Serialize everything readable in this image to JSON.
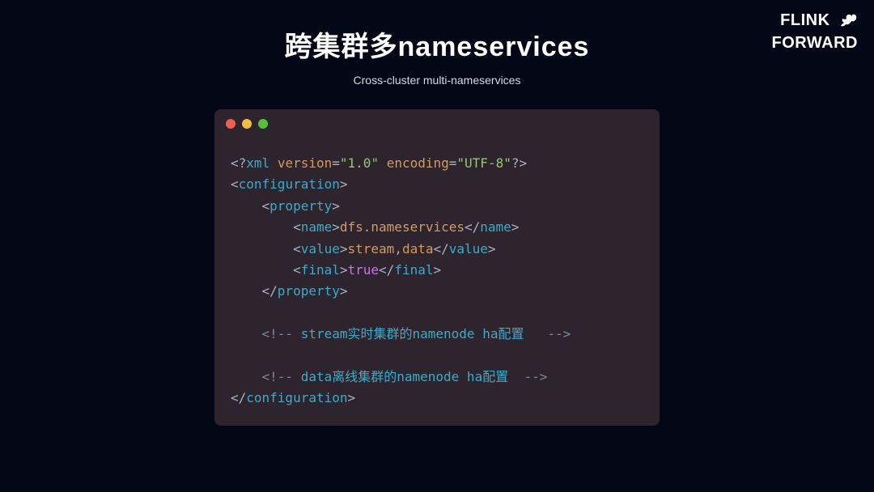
{
  "logo": {
    "line1": "FLINK",
    "line2": "FORWARD"
  },
  "title": {
    "main": "跨集群多nameservices",
    "sub": "Cross-cluster multi-nameservices"
  },
  "code": {
    "xml_decl_open": "<?",
    "xml_decl_name": "xml",
    "xml_attr1": "version",
    "xml_val1": "\"1.0\"",
    "xml_attr2": "encoding",
    "xml_val2": "\"UTF-8\"",
    "xml_decl_close": "?>",
    "tag_configuration": "configuration",
    "tag_property": "property",
    "tag_name": "name",
    "tag_value": "value",
    "tag_final": "final",
    "val_name": "dfs.nameservices",
    "val_value": "stream,data",
    "val_final": "true",
    "cmt_open": "<!-- ",
    "cmt_close": " -->",
    "cmt1_text": "stream实时集群的namenode ha配置  ",
    "cmt2_text": "data离线集群的namenode ha配置 ",
    "lt": "<",
    "gt": ">",
    "lt_slash": "</",
    "eq": "=",
    "sp": " ",
    "indent1": "    ",
    "indent2": "        "
  }
}
